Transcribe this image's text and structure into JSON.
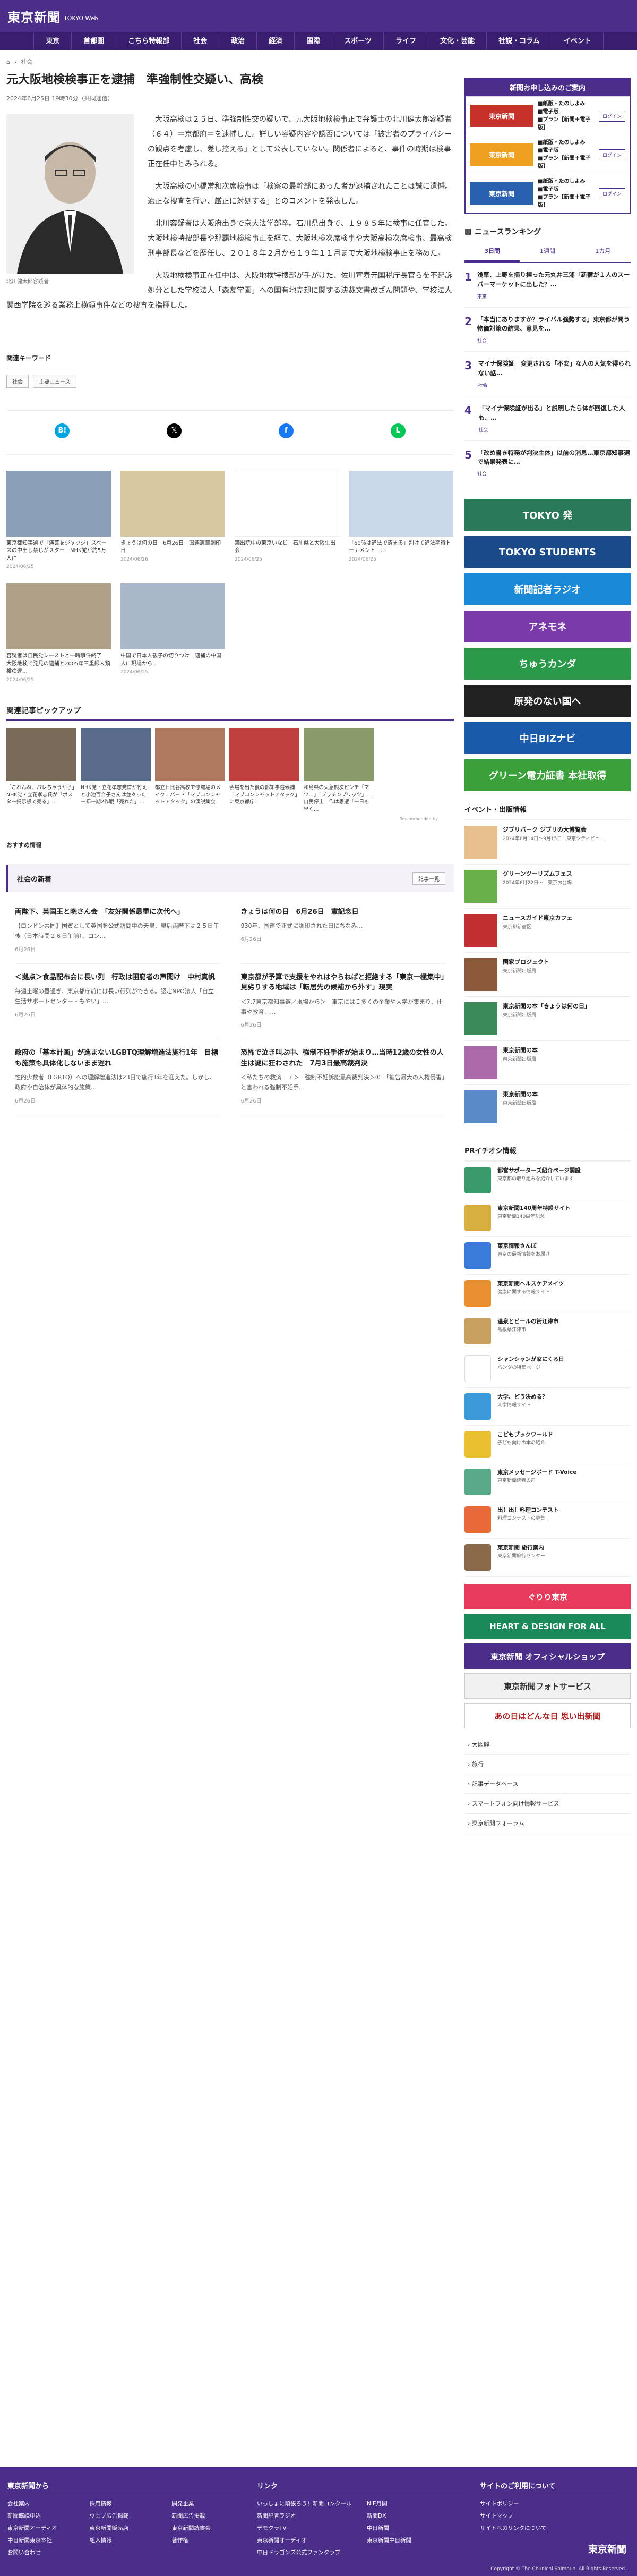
{
  "header": {
    "logo": "東京新聞",
    "logo_sub": "TOKYO Web"
  },
  "nav": [
    "東京",
    "首都圏",
    "こちら特報部",
    "社会",
    "政治",
    "経済",
    "国際",
    "スポーツ",
    "ライフ",
    "文化・芸能",
    "社説・コラム",
    "イベント"
  ],
  "breadcrumb": {
    "home": "⌂",
    "section": "社会"
  },
  "article": {
    "title": "元大阪地検検事正を逮捕　準強制性交疑い、高検",
    "date": "2024年6月25日 19時30分（共同通信）",
    "photo_caption": "北川健太郎容疑者",
    "paragraphs": [
      "大阪高検は２５日、準強制性交の疑いで、元大阪地検検事正で弁護士の北川健太郎容疑者（６４）＝京都府＝を逮捕した。詳しい容疑内容や認否については「被害者のプライバシーの観点を考慮し、差し控える」として公表していない。関係者によると、事件の時期は検事正在任中とみられる。",
      "大阪高検の小橋常和次席検事は「検察の最幹部にあった者が逮捕されたことは誠に遺憾。適正な捜査を行い、厳正に対処する」とのコメントを発表した。",
      "北川容疑者は大阪府出身で京大法学部卒。石川県出身で、１９８５年に検事に任官した。大阪地検特捜部長や那覇地検検事正を経て、大阪地検次席検事や大阪高検次席検事、最高検刑事部長などを歴任し、２０１８年２月から１９年１１月まで大阪地検検事正を務めた。",
      "大阪地検検事正在任中は、大阪地検特捜部が手がけた、佐川宣寿元国税庁長官らを不起訴処分とした学校法人「森友学園」への国有地売却に関する決裁文書改ざん問題や、学校法人関西学院を巡る業務上横領事件などの捜査を指揮した。"
    ]
  },
  "keywords": {
    "label": "関連キーワード",
    "items": [
      "社会",
      "主要ニュース"
    ]
  },
  "share": [
    {
      "icon": "hatena-icon",
      "glyph": "B!",
      "color": "#00a4de"
    },
    {
      "icon": "x-icon",
      "glyph": "𝕏",
      "color": "#000000"
    },
    {
      "icon": "facebook-icon",
      "glyph": "f",
      "color": "#1877f2"
    },
    {
      "icon": "line-icon",
      "glyph": "L",
      "color": "#06c755"
    }
  ],
  "related": [
    {
      "title": "東京都知事選で「演芸をジャッジ」スペースの中出し禁じがスター　NHK党が約5万人に",
      "date": "2024/06/25",
      "color": "#8aa0b8"
    },
    {
      "title": "きょうは何の日　6月26日　国連憲章調印日",
      "date": "2024/06/26",
      "color": "#d8c8a0"
    },
    {
      "title": "築出院中の東京いなじ　石川県と大阪生出会",
      "date": "2024/06/25",
      "color": "#ffffff"
    },
    {
      "title": "「60％は違法で済まる」判けて違法期待トーナメント　…",
      "date": "2024/06/25",
      "color": "#c8d8e8"
    },
    {
      "title": "容疑者は自民党レーストと一時事件終了　大阪地検で発見の逮捕と2005年三重銀人類検の違…",
      "date": "2024/06/25",
      "color": "#b0a088"
    },
    {
      "title": "中国で日本人親子の切りつけ　逮捕の中国人に現場から…",
      "date": "2024/06/25",
      "color": "#a8b8c8"
    }
  ],
  "pickup": {
    "title": "関連記事ピックアップ",
    "items": [
      {
        "title": "「これんね、バレちゃうから」NHK党・立花孝志氏が「ポスター掲示板で売る」…",
        "color": "#7a6a5a"
      },
      {
        "title": "NHK党・立花孝志党首が竹えと小池百合子さんは並々ったー都一期2作戦「売れた」…",
        "color": "#5a6a8a"
      },
      {
        "title": "都立日比谷高校で修羅場のメイク…バード「マブコンシャットアタック」の演説集会",
        "color": "#b07a60"
      },
      {
        "title": "会場を出た後の都知事選候補「マブコンシャットアタック」に東京都庁…",
        "color": "#c04040"
      },
      {
        "title": "和島県の火急熊次ピンチ「マツ…」「ブッチンプリッツ」…自民停止　作は思選「一日も早く…",
        "color": "#8a9a6a"
      }
    ],
    "credit": "Recommended by"
  },
  "recommend_label": "おすすめ情報",
  "society": {
    "title": "社会の新着",
    "more": "記事一覧",
    "items": [
      {
        "title": "両陛下、英国王と晩さん会　「友好関係最重に次代へ」",
        "text": "【ロンドン共同】国賓として英国を公式訪問中の天皇、皇后両陛下は２５日午後（日本時間２６日午前）、ロン…",
        "date": "6月26日"
      },
      {
        "title": "きょうは何の日　6月26日　憲記念日",
        "text": "930年、国連で正式に調印された日にちなみ…",
        "date": "6月26日"
      },
      {
        "title": "＜拠点＞食品配布会に長い列　行政は困窮者の声聞け　中村真帆",
        "text": "毎週土曜の昼過ぎ、東京都庁前には長い行列ができる。認定NPO法人「自立生活サポートセンター・もやい」…",
        "date": "6月26日"
      },
      {
        "title": "東京都が予算で支援をやれはやらねばと拒絶する「東京一極集中」　見劣りする地域は「転居先の候補から外す」現実",
        "text": "＜7.7東京都知事選／現場から＞　東京にはＩ多くの企業や大学が集まり、仕事や教育、…",
        "date": "6月26日"
      },
      {
        "title": "政府の「基本計画」が進まないLGBTQ理解増進法施行1年　目標も施策も具体化しないまま遅れ",
        "text": "性的少数者（LGBTQ）への理解増進法は23日で施行1年を迎えた。しかし、政府や自治体が具体的な施策…",
        "date": "6月26日"
      },
      {
        "title": "恐怖で泣き叫ぶ中、強制不妊手術が始まり…当時12歳の女性の人生は謎に狂わされた　7月3日最高裁判決",
        "text": "＜私たちの救済　７＞　強制不妊訴訟最高裁判決＞①　「被告最大の人権侵害」と言われる強制不妊手…",
        "date": "6月26日"
      }
    ]
  },
  "sidebar": {
    "subscribe": {
      "title": "新聞お申し込みのご案内",
      "rows": [
        {
          "logo": "東京新聞",
          "lines": "■紙版・たのしよみ\n■電子版\n■プラン【新聞＋電子版】",
          "login": "ログイン"
        },
        {
          "logo": "東京新聞",
          "lines": "■紙版・たのしよみ\n■電子版\n■プラン【新聞＋電子版】",
          "login": "ログイン"
        },
        {
          "logo": "東京新聞",
          "lines": "■紙版・たのしよみ\n■電子版\n■プラン【新聞＋電子版】",
          "login": "ログイン"
        }
      ]
    },
    "ranking": {
      "title": "ニュースランキング",
      "tabs": [
        "3日間",
        "1週間",
        "1カ月"
      ],
      "items": [
        {
          "num": "1",
          "text": "浅草、上野を揺り捏った元丸井三浦「新宿が１人のスーパーマーケットに出した？…",
          "cat": "東京"
        },
        {
          "num": "2",
          "text": "「本当にありますか？ライバル強勢する」東京都が問う物価対策の結果、意見を…",
          "cat": "社会"
        },
        {
          "num": "3",
          "text": "マイナ保険証　変更される「不安」な人の人気を得られない話…",
          "cat": "社会"
        },
        {
          "num": "4",
          "text": "「マイナ保険証が出る」と説明したら体が回復した人も、…",
          "cat": "社会"
        },
        {
          "num": "5",
          "text": "「改め書き特務が判決主体」以前の消息…東京都知事選で結果発表に…",
          "cat": "社会"
        }
      ]
    },
    "promos": [
      {
        "text": "TOKYO 発",
        "color": "#2a7a5a"
      },
      {
        "text": "TOKYO STUDENTS",
        "color": "#1a4a8a"
      },
      {
        "text": "新聞記者ラジオ",
        "color": "#1a8ad8"
      },
      {
        "text": "アネモネ",
        "color": "#7a3aaa"
      },
      {
        "text": "ちゅうカンダ",
        "color": "#2a9a4a"
      },
      {
        "text": "原発のない国へ",
        "color": "#222222"
      },
      {
        "text": "中日BIZナビ",
        "color": "#1a5aaa"
      },
      {
        "text": "グリーン電力証書 本社取得",
        "color": "#3aa03a"
      }
    ],
    "events": {
      "title": "イベント・出版情報",
      "items": [
        {
          "title": "ジブリパーク ジブリの大博覧会",
          "sub": "2024年6月14日～9月15日　東京シティビュー",
          "color": "#e8c090"
        },
        {
          "title": "グリーンツーリズムフェス",
          "sub": "2024年6月22日～　東京お台場",
          "color": "#6ab04a"
        },
        {
          "title": "ニュースガイド東京カフェ",
          "sub": "東京都新宿区",
          "color": "#c03030"
        },
        {
          "title": "国家プロジェクト",
          "sub": "東京新聞出版局",
          "color": "#8a5a3a"
        },
        {
          "title": "東京新聞の本「きょうは何の日」",
          "sub": "東京新聞出版局",
          "color": "#3a8a5a"
        },
        {
          "title": "東京新聞の本",
          "sub": "東京新聞出版局",
          "color": "#aa6aaa"
        },
        {
          "title": "東京新聞の本",
          "sub": "東京新聞出版局",
          "color": "#5a8ac8"
        }
      ]
    },
    "pr": {
      "title": "PRイチオシ情報",
      "items": [
        {
          "title": "都営サポーターズ紹介ページ開設",
          "sub": "東京都の取り組みを紹介しています",
          "color": "#3a9a6a"
        },
        {
          "title": "東京新聞140周年特設サイト",
          "sub": "東京新聞140周年記念",
          "color": "#d8b040"
        },
        {
          "title": "東京情報さんぽ",
          "sub": "東京の最新情報をお届け",
          "color": "#3a7ad8"
        },
        {
          "title": "東京新聞ヘルスケアメイツ",
          "sub": "健康に関する情報サイト",
          "color": "#e89030"
        },
        {
          "title": "温泉とビールの街江津市",
          "sub": "島根県江津市",
          "color": "#c8a060"
        },
        {
          "title": "シャンシャンが家にくる日",
          "sub": "パンダの特集ページ",
          "color": "#ffffff"
        },
        {
          "title": "大学、どう決める？",
          "sub": "大学情報サイト",
          "color": "#3a9ad8"
        },
        {
          "title": "こどもブックワールド",
          "sub": "子ども向けの本の紹介",
          "color": "#e8c030"
        },
        {
          "title": "東京メッセージボード T-Voice",
          "sub": "東京新聞読者の声",
          "color": "#5aaa8a"
        },
        {
          "title": "出！出！料理コンテスト",
          "sub": "料理コンテストの募集",
          "color": "#e86a3a"
        },
        {
          "title": "東京新聞 旅行案内",
          "sub": "東京新聞旅行センター",
          "color": "#8a6a4a"
        }
      ]
    },
    "banners": [
      {
        "text": "ぐりり東京",
        "color": "#e83a5a",
        "fg": "#ffffff"
      },
      {
        "text": "HEART & DESIGN FOR ALL",
        "color": "#1a8a5a",
        "fg": "#ffffff"
      },
      {
        "text": "東京新聞 オフィシャルショップ",
        "color": "#4b2d8a",
        "fg": "#ffffff"
      },
      {
        "text": "東京新聞フォトサービス",
        "color": "#f0f0f0",
        "fg": "#333333"
      },
      {
        "text": "あの日はどんな日 思い出新聞",
        "color": "#ffffff",
        "fg": "#b02020"
      }
    ],
    "links": [
      "大図解",
      "旅行",
      "記事データベース",
      "スマートフォン向け情報サービス",
      "東京新聞フォーラム"
    ]
  },
  "footer": {
    "cols": [
      {
        "head": "東京新聞から",
        "links": [
          "会社案内",
          "採用情報",
          "開発企業",
          "新聞購読申込",
          "ウェブ広告掲載",
          "新聞広告掲載",
          "東京新聞オーディオ",
          "東京新聞販売店",
          "東京新聞読書会",
          "中日新聞東京本社",
          "組入情報",
          "著作権",
          "お問い合わせ"
        ]
      },
      {
        "head": "リンク",
        "links": [
          "いっしょに頑張ろう！新聞コンクール",
          "NIE月間",
          "新聞記者ラジオ",
          "新聞DX",
          "デモクラTV",
          "中日新聞",
          "東京新聞オーディオ",
          "東京新聞中日新聞",
          "中日ドラゴンズ公式ファンクラブ"
        ]
      },
      {
        "head": "サイトのご利用について",
        "links": [
          "サイトポリシー",
          "サイトマップ",
          "サイトへのリンクについて"
        ]
      }
    ],
    "logo": "東京新聞",
    "copy": "Copyright © The Chunichi Shimbun, All Rights Reserved."
  }
}
